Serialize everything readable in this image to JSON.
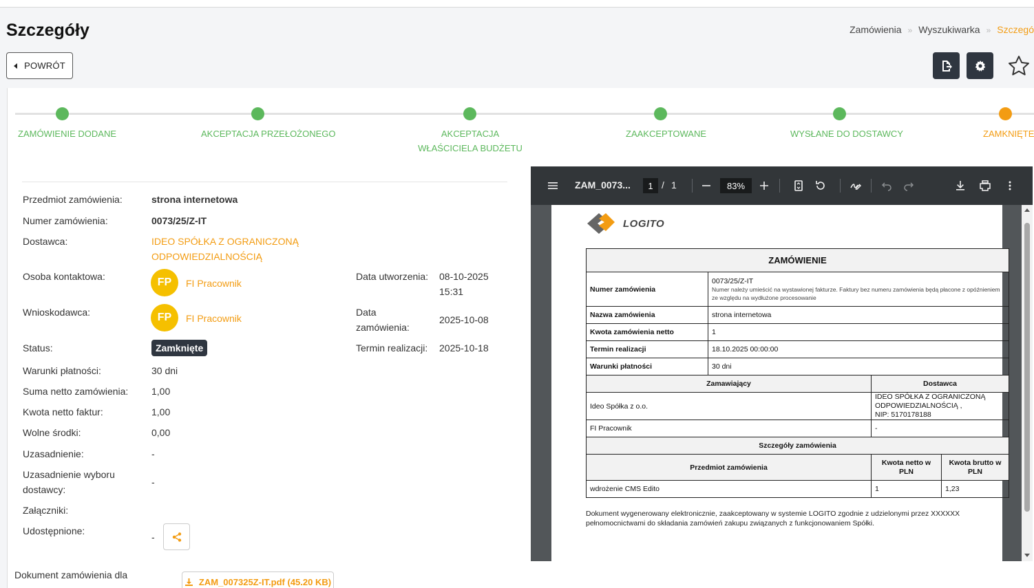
{
  "page_title": "Szczegóły",
  "breadcrumbs": [
    "Zamówienia",
    "Wyszukiwarka",
    "Szczegó"
  ],
  "back_label": "POWRÓT",
  "steps": [
    "ZAMÓWIENIE DODANE",
    "AKCEPTACJA PRZEŁOŻONEGO",
    "AKCEPTACJA WŁAŚCICIELA BUDŻETU",
    "ZAAKCEPTOWANE",
    "WYSŁANE DO DOSTAWCY",
    "ZAMKNIĘTE"
  ],
  "details": {
    "przedmiot_label": "Przedmiot zamówienia:",
    "przedmiot_value": "strona internetowa",
    "numer_label": "Numer zamówienia:",
    "numer_value": "0073/25/Z-IT",
    "dostawca_label": "Dostawca:",
    "dostawca_line1": "IDEO SPÓŁKA Z OGRANICZONĄ",
    "dostawca_line2": "ODPOWIEDZIALNOŚCIĄ",
    "osoba_label": "Osoba kontaktowa:",
    "osoba_initials": "FP",
    "osoba_name": "FI Pracownik",
    "wnioskodawca_label": "Wnioskodawca:",
    "wnioskodawca_initials": "FP",
    "wnioskodawca_name": "FI Pracownik",
    "status_label": "Status:",
    "status_value": "Zamknięte",
    "warunki_label": "Warunki płatności:",
    "warunki_value": "30 dni",
    "suma_label": "Suma netto zamówienia:",
    "suma_value": "1,00",
    "kwota_label": "Kwota netto faktur:",
    "kwota_value": "1,00",
    "wolne_label": "Wolne środki:",
    "wolne_value": "0,00",
    "uzasadnienie_label": "Uzasadnienie:",
    "uzasadnienie_value": "-",
    "uzas_wyboru_line1": "Uzasadnienie wyboru",
    "uzas_wyboru_line2": "dostawcy:",
    "uzas_wyboru_value": "-",
    "zalaczniki_label": "Załączniki:",
    "udostepnione_label": "Udostępnione:",
    "udostepnione_value": "-",
    "data_utw_label": "Data utworzenia:",
    "data_utw_line1": "08-10-2025",
    "data_utw_line2": "15:31",
    "data_zam_line1": "Data",
    "data_zam_line2": "zamówienia:",
    "data_zam_value": "2025-10-08",
    "termin_label": "Termin realizacji:",
    "termin_value": "2025-10-18",
    "dokument_label": "Dokument zamówienia dla",
    "dokument_file": "ZAM_007325Z-IT.pdf (45.20 KB)"
  },
  "viewer": {
    "filename": "ZAM_0073...",
    "page_current": "1",
    "page_sep": "/",
    "page_total": "1",
    "zoom": "83%",
    "logo": "LOGITO",
    "doc_title": "ZAMÓWIENIE",
    "rows": [
      {
        "label": "Numer zamówienia",
        "value": "0073/25/Z-IT",
        "note": "Numer należy umieścić na wystawionej fakturze. Faktury bez numeru zamówienia będą płacone z opóźnieniem ze względu na wydłużone procesowanie"
      },
      {
        "label": "Nazwa zamówienia",
        "value": "strona internetowa"
      },
      {
        "label": "Kwota zamówienia netto",
        "value": "1"
      },
      {
        "label": "Termin realizacji",
        "value": "18.10.2025 00:00:00"
      },
      {
        "label": "Warunki płatności",
        "value": "30 dni"
      }
    ],
    "zamawiajacy_header": "Zamawiający",
    "dostawca_header": "Dostawca",
    "zamawiajacy_value": "Ideo Spółka z o.o.",
    "dostawca_value_line1": "IDEO SPÓŁKA Z OGRANICZONĄ ODPOWIEDZIALNOŚCIĄ ,",
    "dostawca_value_line2": "NIP: 5170178188",
    "contact_value": "FI Pracownik",
    "contact_dostawca": "-",
    "szczegoly_header": "Szczegóły zamówienia",
    "col_przedmiot": "Przedmiot zamówienia",
    "col_netto_line1": "Kwota netto w",
    "col_netto_line2": "PLN",
    "col_brutto_line1": "Kwota brutto w",
    "col_brutto_line2": "PLN",
    "item_name": "wdrożenie CMS Edito",
    "item_netto": "1",
    "item_brutto": "1,23",
    "footnote_line1": "Dokument wygenerowany elektronicznie, zaakceptowany w systemie LOGITO zgodnie z udzielonymi przez XXXXXX",
    "footnote_line2": "pełnomocnictwami do składania zamówień zakupu związanych z funkcjonowaniem Spółki."
  },
  "colors": {
    "accent": "#f39c12",
    "success": "#5cb85c",
    "dark": "#2f3640",
    "avatar": "#f5c000"
  },
  "icons": [
    "arrow-left-icon",
    "export-icon",
    "gear-icon",
    "star-icon",
    "share-icon",
    "download-icon",
    "menu-icon",
    "fit-page-icon",
    "rotate-icon",
    "annotate-icon",
    "undo-icon",
    "redo-icon",
    "print-icon",
    "more-icon"
  ]
}
